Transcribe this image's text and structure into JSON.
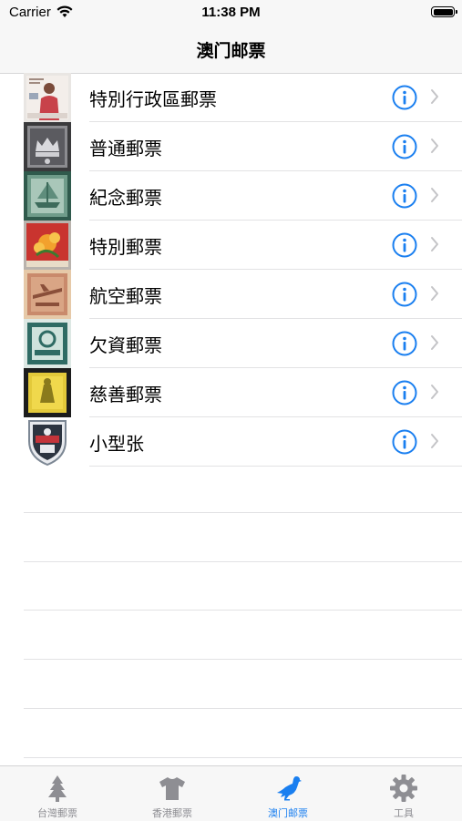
{
  "status_bar": {
    "carrier": "Carrier",
    "time": "11:38 PM"
  },
  "nav": {
    "title": "澳门邮票"
  },
  "rows": [
    {
      "label": "特別行政區郵票",
      "thumb": "stamp-portrait"
    },
    {
      "label": "普通郵票",
      "thumb": "stamp-crown"
    },
    {
      "label": "紀念郵票",
      "thumb": "stamp-ship"
    },
    {
      "label": "特別郵票",
      "thumb": "stamp-flower"
    },
    {
      "label": "航空郵票",
      "thumb": "stamp-airmail"
    },
    {
      "label": "欠資郵票",
      "thumb": "stamp-postage-due"
    },
    {
      "label": "慈善郵票",
      "thumb": "stamp-charity"
    },
    {
      "label": "小型张",
      "thumb": "shield-emblem"
    }
  ],
  "tabs": [
    {
      "label": "台灣郵票",
      "icon": "tree-icon",
      "active": false
    },
    {
      "label": "香港郵票",
      "icon": "tshirt-icon",
      "active": false
    },
    {
      "label": "澳门邮票",
      "icon": "bird-icon",
      "active": true
    },
    {
      "label": "工具",
      "icon": "gear-icon",
      "active": false
    }
  ],
  "colors": {
    "accent": "#1a7ff0",
    "inactive": "#8e8e93"
  }
}
